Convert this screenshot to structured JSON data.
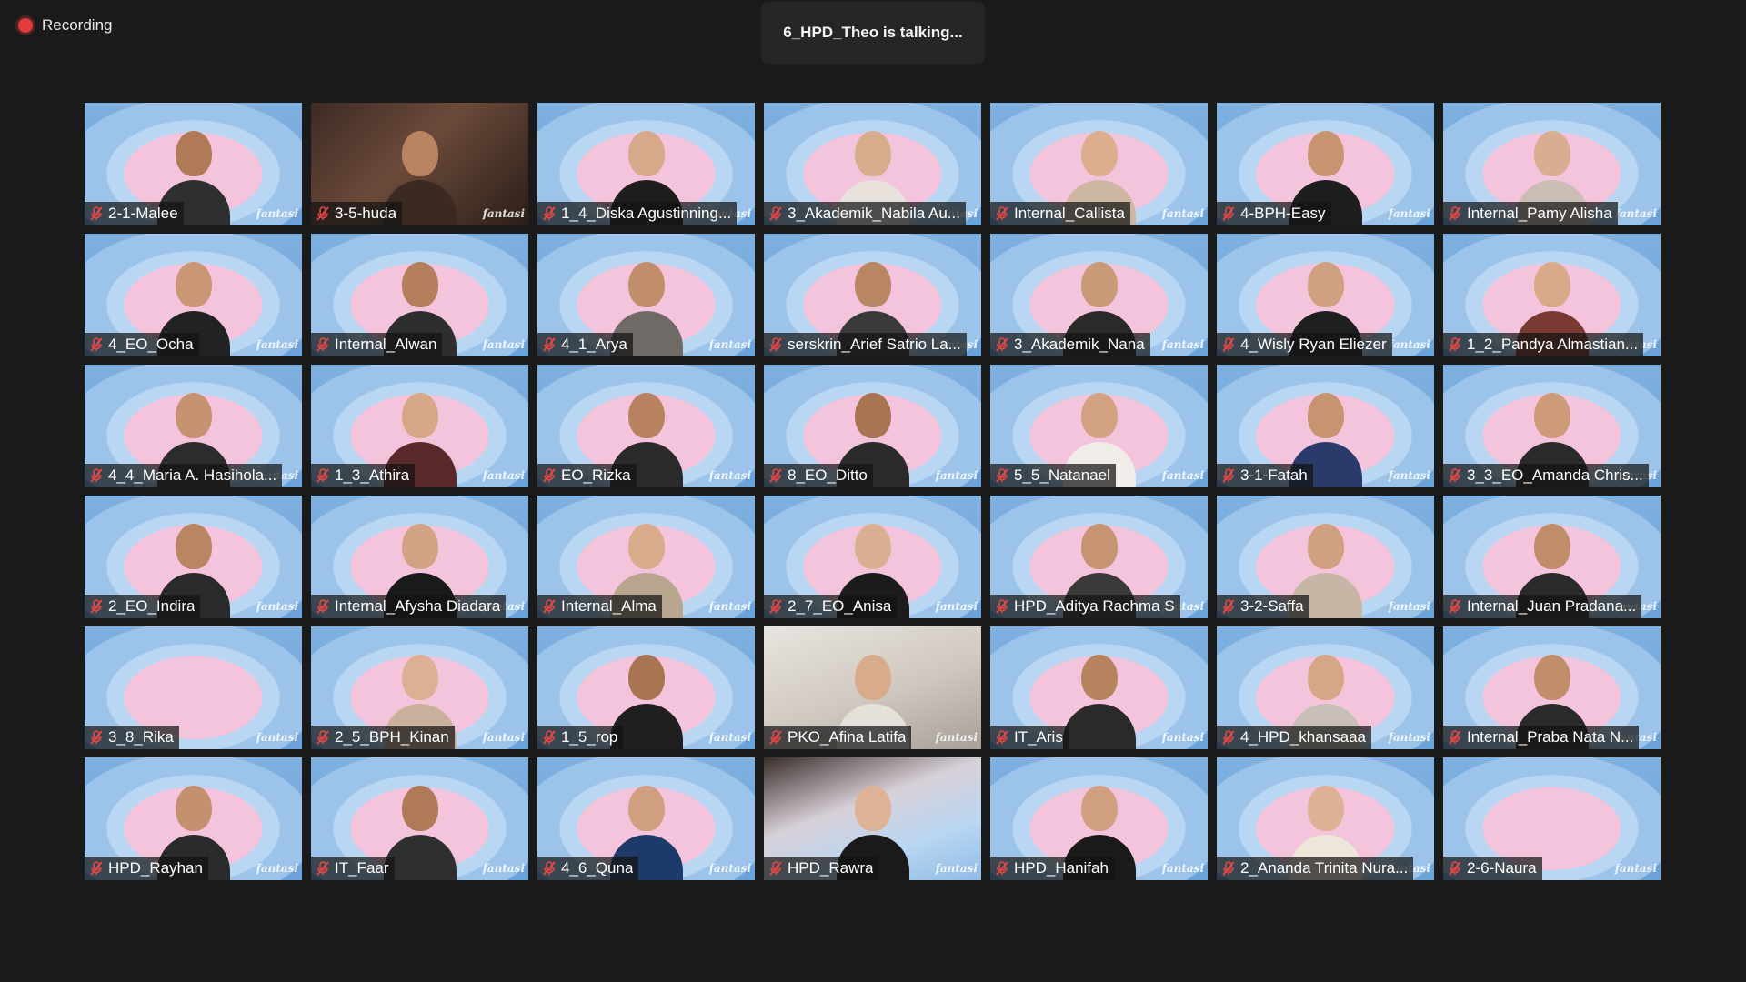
{
  "recording": {
    "label": "Recording"
  },
  "speaker": {
    "text": "6_HPD_Theo is talking..."
  },
  "brand": "fantasi",
  "participants": [
    {
      "name": "2-1-Malee",
      "bg": "tile",
      "skin": "#b07a56",
      "shirt": "#2f2f2f"
    },
    {
      "name": "3-5-huda",
      "bg": "tile photo",
      "skin": "#b98462",
      "shirt": "#3b2a22"
    },
    {
      "name": "1_4_Diska Agustinning...",
      "bg": "tile",
      "skin": "#d6a98a",
      "shirt": "#1e1e1e"
    },
    {
      "name": "3_Akademik_Nabila Au...",
      "bg": "tile",
      "skin": "#d8ad8e",
      "shirt": "#e8e1dc"
    },
    {
      "name": "Internal_Callista",
      "bg": "tile",
      "skin": "#dcae8e",
      "shirt": "#cdb7a2"
    },
    {
      "name": "4-BPH-Easy",
      "bg": "tile",
      "skin": "#c99571",
      "shirt": "#1e1e1e"
    },
    {
      "name": "Internal_Pamy Alisha",
      "bg": "tile",
      "skin": "#d9ad8f",
      "shirt": "#cbbfb5"
    },
    {
      "name": "4_EO_Ocha",
      "bg": "tile",
      "skin": "#c99676",
      "shirt": "#222222"
    },
    {
      "name": "Internal_Alwan",
      "bg": "tile",
      "skin": "#b57f5c",
      "shirt": "#2e2e2e"
    },
    {
      "name": "4_1_Arya",
      "bg": "tile",
      "skin": "#c18e6c",
      "shirt": "#6f6a66"
    },
    {
      "name": "serskrin_Arief Satrio La...",
      "bg": "tile",
      "skin": "#b88661",
      "shirt": "#3a3a3a"
    },
    {
      "name": "3_Akademik_Nana",
      "bg": "tile",
      "skin": "#c99a78",
      "shirt": "#2a2a2a"
    },
    {
      "name": "4_Wisly Ryan Eliezer",
      "bg": "tile",
      "skin": "#d0a080",
      "shirt": "#1f1f1f"
    },
    {
      "name": "1_2_Pandya Almastian...",
      "bg": "tile",
      "skin": "#d8aa8a",
      "shirt": "#7a3a34"
    },
    {
      "name": "4_4_Maria A. Hasihola...",
      "bg": "tile",
      "skin": "#c59272",
      "shirt": "#2c2c2c"
    },
    {
      "name": "1_3_Athira",
      "bg": "tile",
      "skin": "#d6a888",
      "shirt": "#5a2a2a"
    },
    {
      "name": "EO_Rizka",
      "bg": "tile",
      "skin": "#b88260",
      "shirt": "#2a2a2a"
    },
    {
      "name": "8_EO_Ditto",
      "bg": "tile",
      "skin": "#a87452",
      "shirt": "#2b2b2b"
    },
    {
      "name": "5_5_Natanael",
      "bg": "tile",
      "skin": "#d2a282",
      "shirt": "#f0ece8"
    },
    {
      "name": "3-1-Fatah",
      "bg": "tile",
      "skin": "#c89370",
      "shirt": "#2a3a6a"
    },
    {
      "name": "3_3_EO_Amanda Chris...",
      "bg": "tile",
      "skin": "#cd9b79",
      "shirt": "#2a2a2a"
    },
    {
      "name": "2_EO_Indira",
      "bg": "tile",
      "skin": "#b98562",
      "shirt": "#2a2a2a"
    },
    {
      "name": "Internal_Afysha Diadara",
      "bg": "tile",
      "skin": "#d1a283",
      "shirt": "#1a1a1a"
    },
    {
      "name": "Internal_Alma",
      "bg": "tile",
      "skin": "#d8ab8b",
      "shirt": "#b8a58e"
    },
    {
      "name": "2_7_EO_Anisa",
      "bg": "tile",
      "skin": "#dbb092",
      "shirt": "#1c1c1c"
    },
    {
      "name": "HPD_Aditya Rachma S",
      "bg": "tile",
      "skin": "#c69472",
      "shirt": "#3a3a3a"
    },
    {
      "name": "3-2-Saffa",
      "bg": "tile",
      "skin": "#d0a080",
      "shirt": "#c7b6a6"
    },
    {
      "name": "Internal_Juan Pradana...",
      "bg": "tile",
      "skin": "#c08c69",
      "shirt": "#2a2a2a"
    },
    {
      "name": "3_8_Rika",
      "bg": "tile",
      "skin": "",
      "shirt": ""
    },
    {
      "name": "2_5_BPH_Kinan",
      "bg": "tile",
      "skin": "#dcb093",
      "shirt": "#c9b09a"
    },
    {
      "name": "1_5_rop",
      "bg": "tile",
      "skin": "#a87452",
      "shirt": "#1f1f1f"
    },
    {
      "name": "PKO_Afina Latifa",
      "bg": "tile room",
      "skin": "#d7ab8c",
      "shirt": "#e6e0da"
    },
    {
      "name": "IT_Aris",
      "bg": "tile",
      "skin": "#b7835f",
      "shirt": "#2a2a2a"
    },
    {
      "name": "4_HPD_khansaaa",
      "bg": "tile",
      "skin": "#d6a786",
      "shirt": "#c8c0b8"
    },
    {
      "name": "Internal_Praba Nata N...",
      "bg": "tile",
      "skin": "#c18d6a",
      "shirt": "#2a2a2a"
    },
    {
      "name": "HPD_Rayhan",
      "bg": "tile",
      "skin": "#c49170",
      "shirt": "#2a2a2a"
    },
    {
      "name": "IT_Faar",
      "bg": "tile",
      "skin": "#b07a57",
      "shirt": "#2f2f2f"
    },
    {
      "name": "4_6_Quna",
      "bg": "tile",
      "skin": "#cf9f7f",
      "shirt": "#1e3a6a"
    },
    {
      "name": "HPD_Rawra",
      "bg": "tile room2",
      "skin": "#ddb296",
      "shirt": "#1a1a1a"
    },
    {
      "name": "HPD_Hanifah",
      "bg": "tile",
      "skin": "#d0a081",
      "shirt": "#1a1a1a"
    },
    {
      "name": "2_Ananda Trinita Nura...",
      "bg": "tile",
      "skin": "#dcb194",
      "shirt": "#efe6da"
    },
    {
      "name": "2-6-Naura",
      "bg": "tile",
      "skin": "",
      "shirt": ""
    }
  ]
}
